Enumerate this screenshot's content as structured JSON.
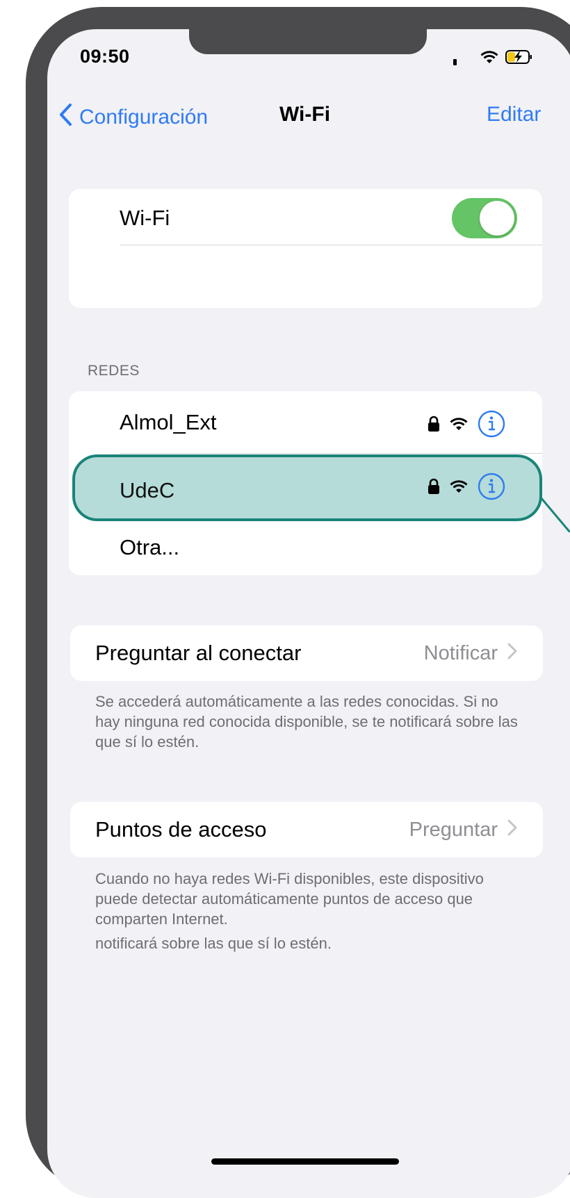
{
  "status_bar": {
    "time": "09:50"
  },
  "nav": {
    "back_label": "Configuración",
    "title": "Wi-Fi",
    "edit_label": "Editar"
  },
  "wifi_toggle": {
    "label": "Wi-Fi",
    "on": true
  },
  "networks": {
    "section_title": "REDES",
    "items": [
      {
        "name": "Almol_Ext",
        "locked": true,
        "highlighted": false
      },
      {
        "name": "UdeC",
        "locked": true,
        "highlighted": true
      }
    ],
    "other_label": "Otra..."
  },
  "ask_to_join": {
    "label": "Preguntar al conectar",
    "value": "Notificar",
    "footnote": "Se accederá automáticamente a las redes conocidas. Si no hay ninguna red conocida disponible, se te notificará sobre las que sí lo estén."
  },
  "hotspot": {
    "label": "Puntos de acceso",
    "value": "Preguntar",
    "footnote": "Cuando no haya redes Wi-Fi disponibles, este dispositivo puede detectar automáticamente puntos de acceso que comparten Internet.",
    "footnote_extra": "notificará sobre las que sí lo estén."
  },
  "colors": {
    "accent": "#2f7bf3",
    "toggle_on": "#64c466",
    "highlight_fill": "#b5dcd8",
    "highlight_border": "#1a8478"
  }
}
